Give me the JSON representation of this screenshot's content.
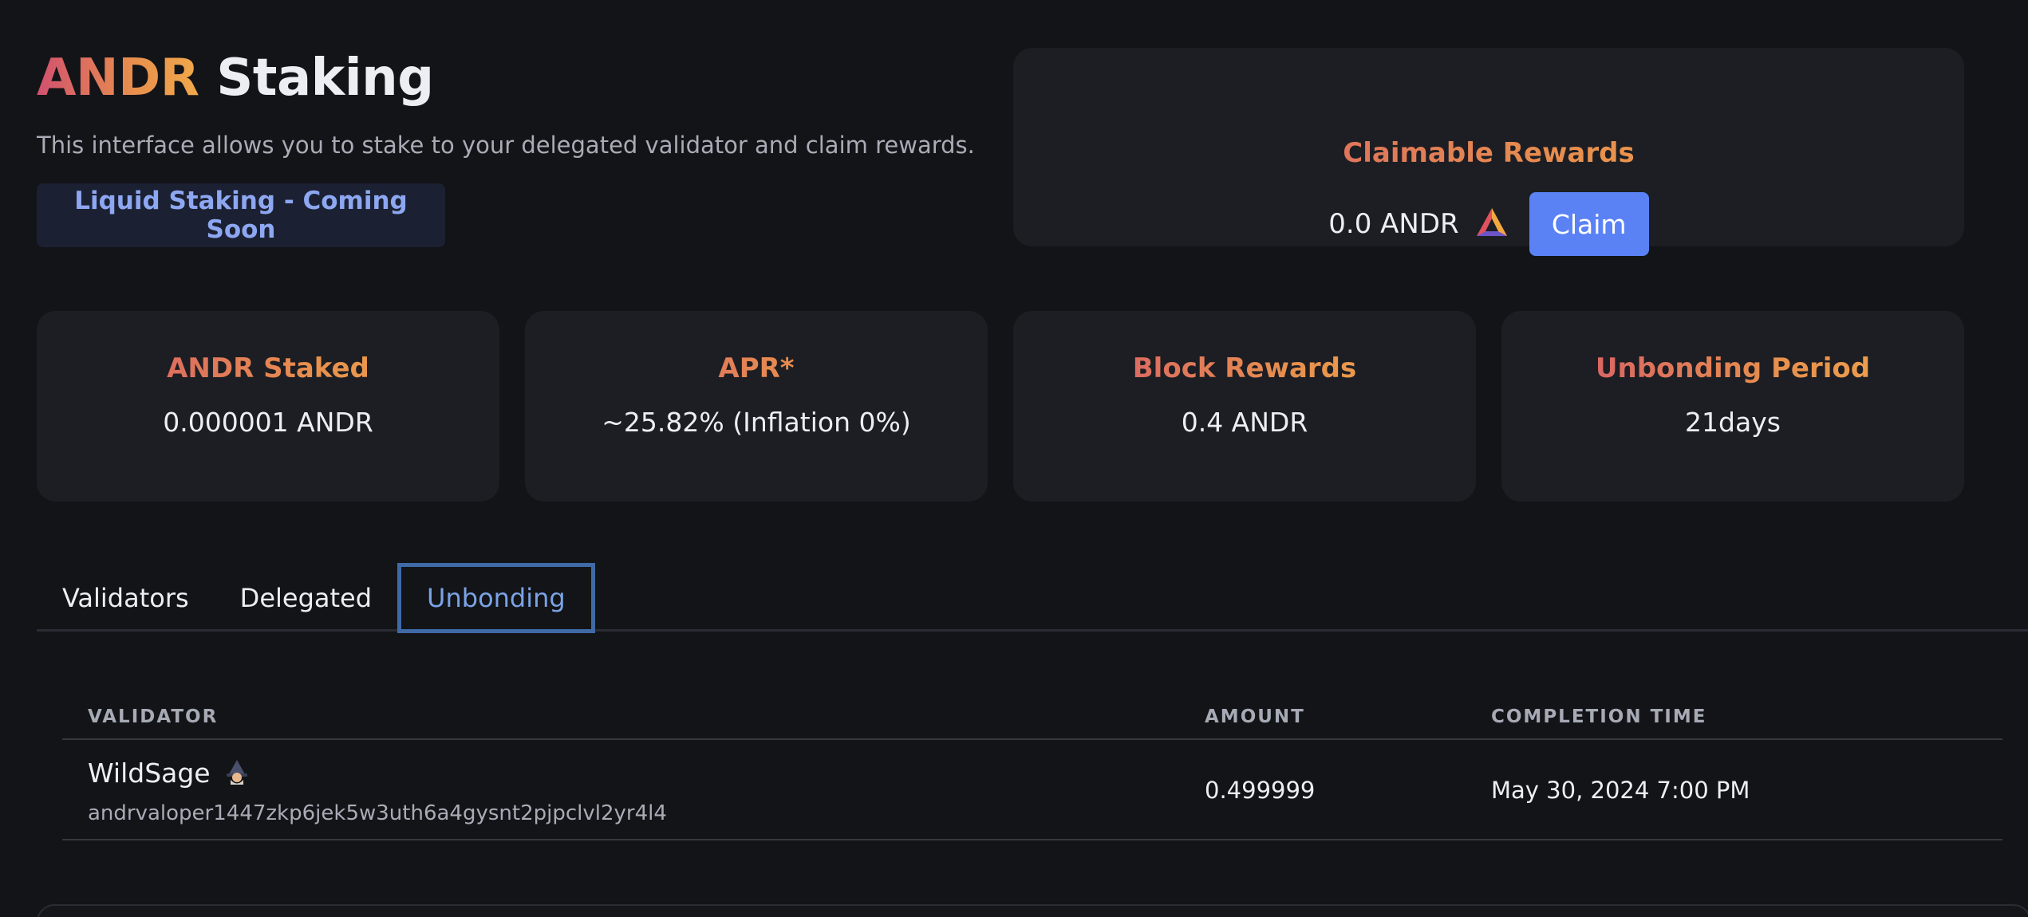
{
  "header": {
    "title_accent": "ANDR",
    "title_rest": " Staking",
    "subtitle": "This interface allows you to stake to your delegated validator and claim rewards.",
    "liquid_staking_label": "Liquid Staking - Coming Soon"
  },
  "rewards": {
    "title": "Claimable Rewards",
    "amount": "0.0 ANDR",
    "token_icon": "andr-token-icon",
    "claim_label": "Claim"
  },
  "stats": [
    {
      "label": "ANDR Staked",
      "value": "0.000001 ANDR"
    },
    {
      "label": "APR*",
      "value": "~25.82% (Inflation 0%)"
    },
    {
      "label": "Block Rewards",
      "value": "0.4 ANDR"
    },
    {
      "label": "Unbonding Period",
      "value": "21days"
    }
  ],
  "tabs": [
    {
      "label": "Validators",
      "active": false
    },
    {
      "label": "Delegated",
      "active": false
    },
    {
      "label": "Unbonding",
      "active": true
    }
  ],
  "table": {
    "columns": [
      "VALIDATOR",
      "AMOUNT",
      "COMPLETION TIME"
    ],
    "rows": [
      {
        "validator_name": "WildSage",
        "validator_icon": "sage-emoji-icon",
        "validator_address": "andrvaloper1447zkp6jek5w3uth6a4gysnt2pjpclvl2yr4l4",
        "amount": "0.499999",
        "completion_time": "May 30, 2024 7:00 PM"
      }
    ]
  },
  "colors": {
    "background": "#131418",
    "card": "#1d1e23",
    "accent_gradient_start": "#d2516f",
    "accent_gradient_end": "#f0a94a",
    "claim_button": "#5a82f5",
    "active_tab": "#7aa3e6"
  }
}
